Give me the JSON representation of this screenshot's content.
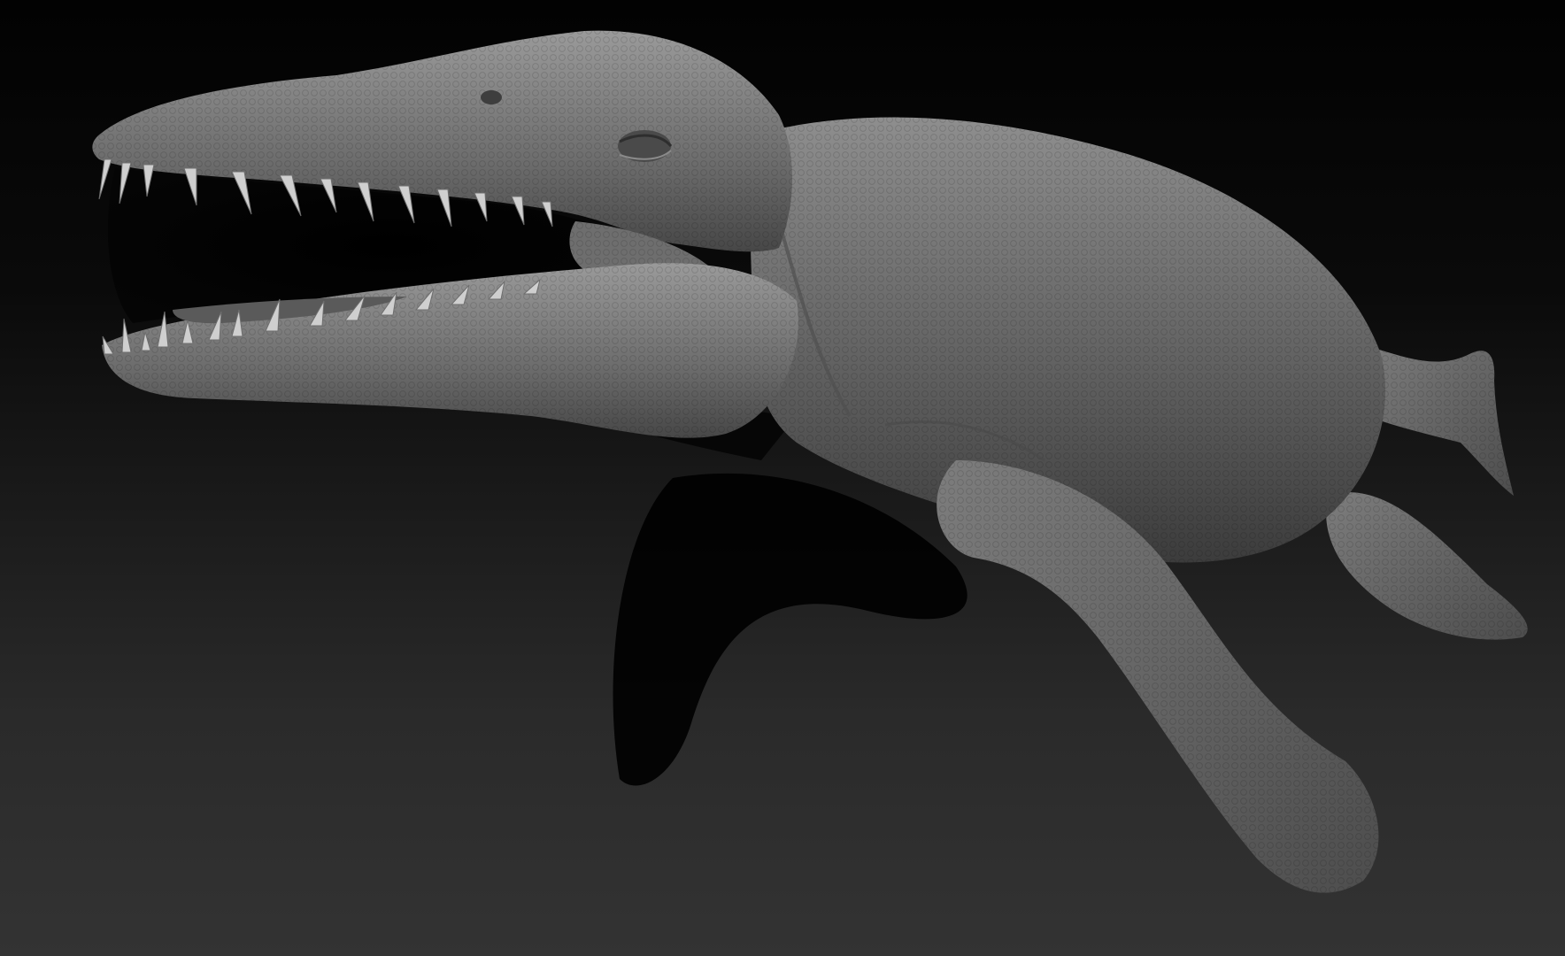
{
  "scene": {
    "subject": "sculpted-marine-reptile",
    "colors": {
      "background_top": "#020202",
      "background_bottom": "#333333",
      "sculpt_base": "#6b6b6b",
      "sculpt_light": "#9a9a9a",
      "sculpt_shadow": "#3a3a3a",
      "cast_shadow": "#000000",
      "tooth": "#cfcfcf"
    },
    "icons": {
      "subject_icon": "reptile-sculpt-icon"
    }
  }
}
